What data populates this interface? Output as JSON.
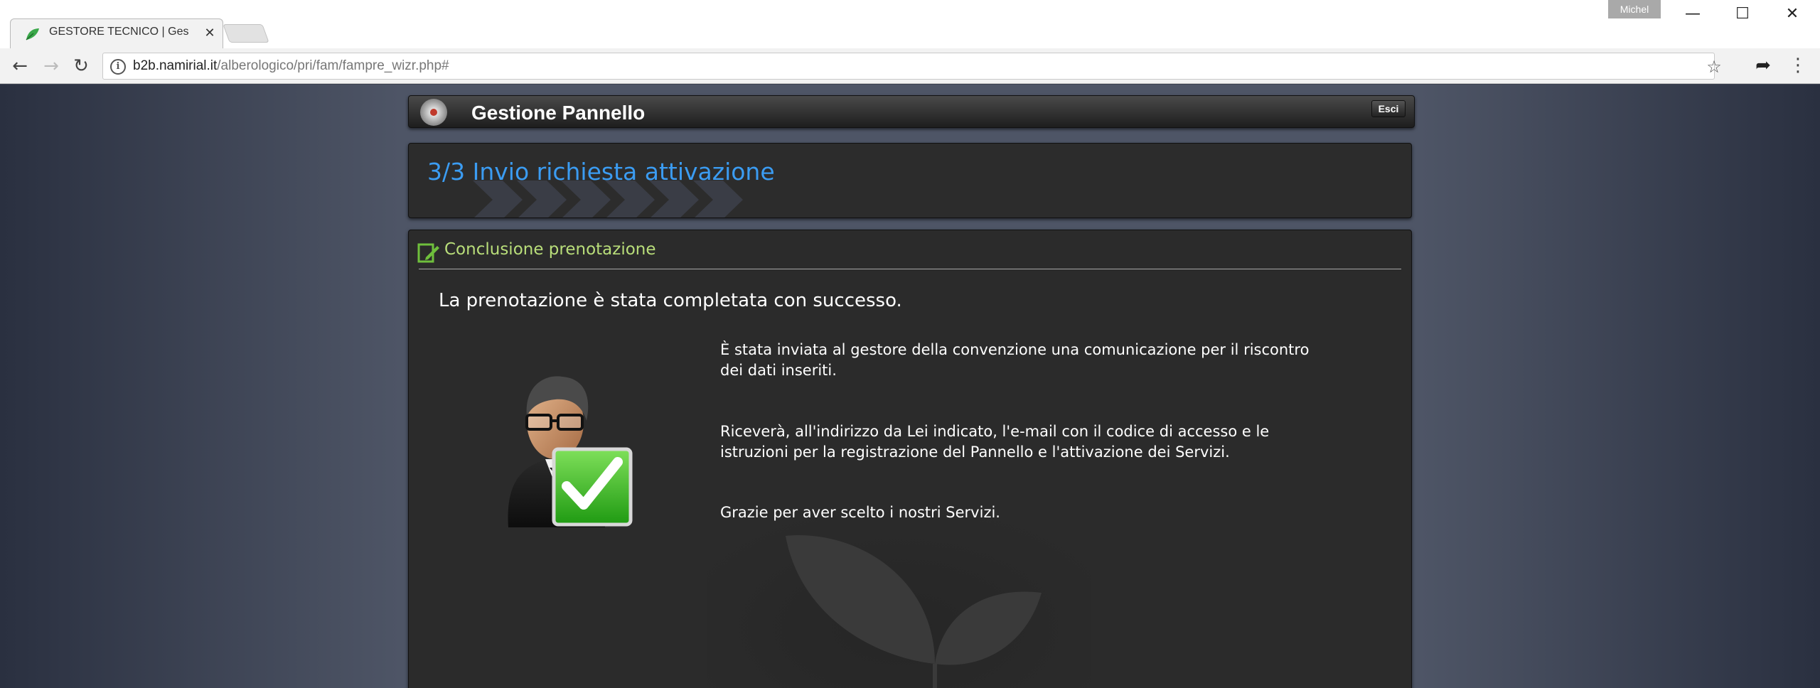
{
  "browser": {
    "tab_title": "GESTORE TECNICO | Ges",
    "tab_close": "✕",
    "user_label": "Michel",
    "window_controls": {
      "minimize": "—",
      "maximize": "☐",
      "close": "✕"
    },
    "url_host": "b2b.namirial.it",
    "url_path": "/alberologico/pri/fam/fampre_wizr.php#",
    "icons": {
      "back": "←",
      "forward": "→",
      "reload": "↻",
      "info": "i",
      "star": "☆",
      "share": "➦",
      "menu": "⋮"
    }
  },
  "header": {
    "title": "Gestione Pannello",
    "exit_label": "Esci"
  },
  "step": {
    "title": "3/3 Invio richiesta attivazione"
  },
  "section": {
    "title": "Conclusione prenotazione",
    "success_message": "La prenotazione è stata completata con successo.",
    "paragraphs": [
      "È stata inviata al gestore della convenzione una comunicazione per il riscontro dei dati inseriti.",
      "Riceverà, all'indirizzo da Lei indicato, l'e-mail con il codice di accesso e le istruzioni per la registrazione del Pannello e l'attivazione dei Servizi.",
      "Grazie per aver scelto i nostri Servizi."
    ]
  },
  "colors": {
    "step_title": "#3b9cf2",
    "section_title": "#b9de7a",
    "panel_bg": "#2b2b2b",
    "check_green": "#3dbd1c"
  }
}
